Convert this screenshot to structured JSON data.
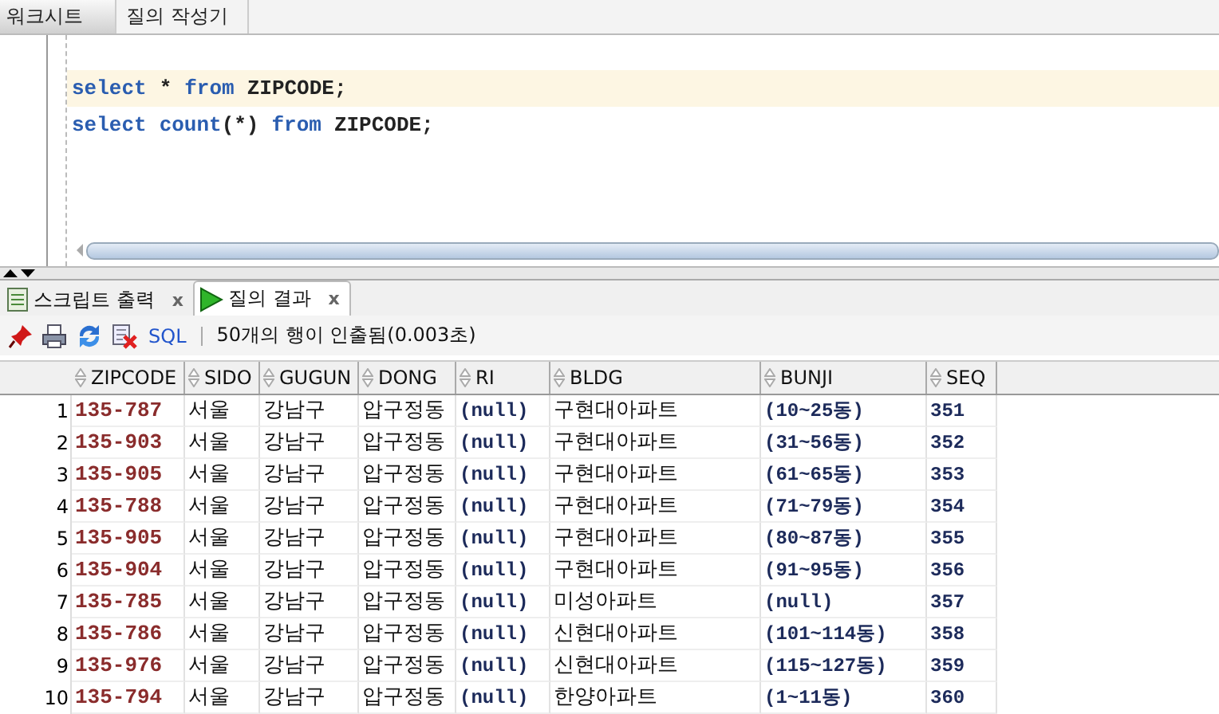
{
  "worksheet_tabs": [
    {
      "label": "워크시트",
      "selected": true
    },
    {
      "label": "질의 작성기",
      "selected": false
    }
  ],
  "editor": {
    "lines": [
      {
        "current": true,
        "tokens": [
          {
            "kind": "keyword",
            "text": "select"
          },
          {
            "kind": "plain",
            "text": "*"
          },
          {
            "kind": "keyword",
            "text": "from"
          },
          {
            "kind": "plain",
            "text": "ZIPCODE;"
          }
        ]
      },
      {
        "current": false,
        "tokens": [
          {
            "kind": "keyword",
            "text": "select"
          },
          {
            "kind": "keyword",
            "text": "count"
          },
          {
            "kind": "plain",
            "text": "(*)"
          },
          {
            "kind": "keyword",
            "text": "from"
          },
          {
            "kind": "plain",
            "text": "ZIPCODE;"
          }
        ]
      }
    ]
  },
  "result_tabs": [
    {
      "label": "스크립트 출력",
      "kind": "script",
      "selected": false,
      "close": "x"
    },
    {
      "label": "질의 결과",
      "kind": "run",
      "selected": true,
      "close": "x"
    }
  ],
  "toolbar": {
    "sql_link": "SQL",
    "status": "50개의 행이 인출됨(0.003초)"
  },
  "table": {
    "columns": [
      {
        "label": "ZIPCODE",
        "kind": "code"
      },
      {
        "label": "SIDO",
        "kind": "text"
      },
      {
        "label": "GUGUN",
        "kind": "text"
      },
      {
        "label": "DONG",
        "kind": "text"
      },
      {
        "label": "RI",
        "kind": "mono"
      },
      {
        "label": "BLDG",
        "kind": "text"
      },
      {
        "label": "BUNJI",
        "kind": "mono"
      },
      {
        "label": "SEQ",
        "kind": "mono"
      }
    ],
    "rows": [
      {
        "num": "1",
        "cells": [
          "135-787",
          "서울",
          "강남구",
          "압구정동",
          "(null)",
          "구현대아파트",
          "(10~25동)",
          "351"
        ]
      },
      {
        "num": "2",
        "cells": [
          "135-903",
          "서울",
          "강남구",
          "압구정동",
          "(null)",
          "구현대아파트",
          "(31~56동)",
          "352"
        ]
      },
      {
        "num": "3",
        "cells": [
          "135-905",
          "서울",
          "강남구",
          "압구정동",
          "(null)",
          "구현대아파트",
          "(61~65동)",
          "353"
        ]
      },
      {
        "num": "4",
        "cells": [
          "135-788",
          "서울",
          "강남구",
          "압구정동",
          "(null)",
          "구현대아파트",
          "(71~79동)",
          "354"
        ]
      },
      {
        "num": "5",
        "cells": [
          "135-905",
          "서울",
          "강남구",
          "압구정동",
          "(null)",
          "구현대아파트",
          "(80~87동)",
          "355"
        ]
      },
      {
        "num": "6",
        "cells": [
          "135-904",
          "서울",
          "강남구",
          "압구정동",
          "(null)",
          "구현대아파트",
          "(91~95동)",
          "356"
        ]
      },
      {
        "num": "7",
        "cells": [
          "135-785",
          "서울",
          "강남구",
          "압구정동",
          "(null)",
          "미성아파트",
          "(null)",
          "357"
        ]
      },
      {
        "num": "8",
        "cells": [
          "135-786",
          "서울",
          "강남구",
          "압구정동",
          "(null)",
          "신현대아파트",
          "(101~114동)",
          "358"
        ]
      },
      {
        "num": "9",
        "cells": [
          "135-976",
          "서울",
          "강남구",
          "압구정동",
          "(null)",
          "신현대아파트",
          "(115~127동)",
          "359"
        ]
      },
      {
        "num": "10",
        "cells": [
          "135-794",
          "서울",
          "강남구",
          "압구정동",
          "(null)",
          "한양아파트",
          "(1~11동)",
          "360"
        ]
      }
    ]
  }
}
